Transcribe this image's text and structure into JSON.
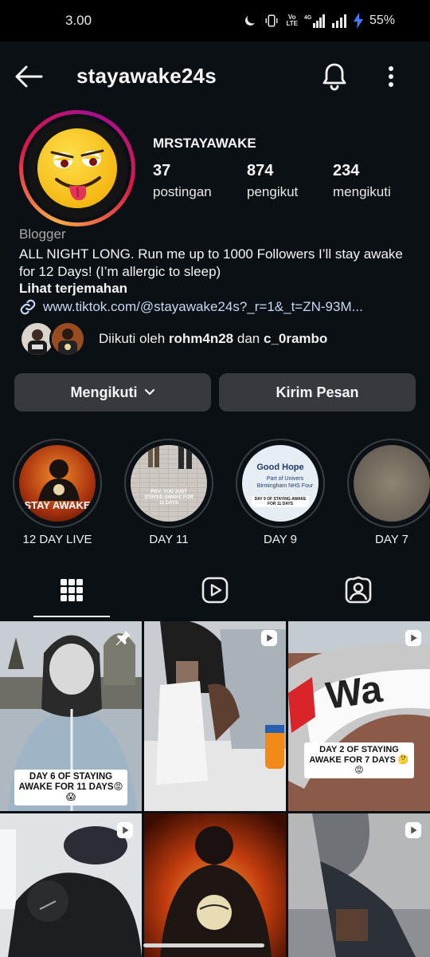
{
  "status_bar": {
    "time": "3.00",
    "battery_percent": "55%",
    "lte_label_top": "Vo",
    "lte_label_bottom": "LTE",
    "network": "4G"
  },
  "header": {
    "username": "stayawake24s"
  },
  "profile": {
    "display_name": "MRSTAYAWAKE",
    "stats": [
      {
        "value": "37",
        "label": "postingan"
      },
      {
        "value": "874",
        "label": "pengikut"
      },
      {
        "value": "234",
        "label": "mengikuti"
      }
    ],
    "category": "Blogger",
    "bio": "ALL NIGHT LONG. Run me up to 1000 Followers I’ll stay awake for 12 Days! (I’m allergic to sleep)",
    "translate_label": "Lihat terjemahan",
    "link": "www.tiktok.com/@stayawake24s?_r=1&_t=ZN-93M...",
    "followed_by": {
      "prefix": "Diikuti oleh",
      "user1": "rohm4n28",
      "conjunction": "dan",
      "user2": "c_0rambo"
    }
  },
  "actions": {
    "follow_label": "Mengikuti",
    "message_label": "Kirim Pesan"
  },
  "highlights": [
    {
      "label": "12 DAY LIVE",
      "thumb_text": "STAY AWAKE"
    },
    {
      "label": "DAY 11",
      "thumb_text": "POV: YOU JUST STAYED AWAKE FOR 11 DAYS"
    },
    {
      "label": "DAY 9",
      "thumb_text": "Good Hope",
      "thumb_sub": "Part of Univers Birmingham NHS Four",
      "thumb_caption": "DAY 9 OF STAYING AWAKE FOR 11 DAYS"
    },
    {
      "label": "DAY 7",
      "thumb_text": ""
    }
  ],
  "tabs": {
    "active": "grid",
    "icons": [
      "grid-icon",
      "reels-icon",
      "tagged-icon"
    ]
  },
  "posts": [
    {
      "caption": "DAY 6 OF STAYING AWAKE FOR 11 DAYS😡😱",
      "pinned": true
    },
    {
      "caption": "",
      "reel": true
    },
    {
      "caption": "DAY 2 OF STAYING AWAKE FOR 7 DAYS 🤔😡",
      "reel": true,
      "sign_text": "Wa"
    },
    {
      "caption": "",
      "reel": true
    },
    {
      "caption": "",
      "reel": false
    },
    {
      "caption": "",
      "reel": true
    }
  ],
  "colors": {
    "background": "#0b1014",
    "button": "#363a3f",
    "link": "#c4d7f5",
    "story_ring_start": "#fbaa47",
    "story_ring_end": "#a60f93"
  }
}
